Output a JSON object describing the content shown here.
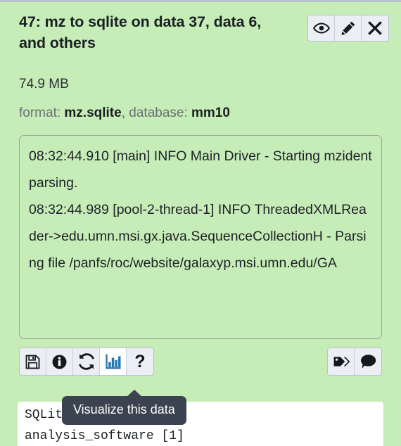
{
  "dataset": {
    "title": "47: mz to sqlite on data 37, data 6, and others",
    "size": "74.9 MB",
    "format_label": "format: ",
    "format_value": "mz.sqlite",
    "database_label": ", database: ",
    "database_value": "mm10",
    "log_text": "08:32:44.910 [main] INFO Main Driver - Starting mzident parsing.\n08:32:44.989 [pool-2-thread-1] INFO ThreadedXMLReader->edu.umn.msi.gx.java.SequenceCollectionH - Parsing file /panfs/roc/website/galaxyp.msi.umn.edu/GA"
  },
  "title_buttons": [
    {
      "name": "display-button",
      "icon": "eye-icon",
      "title": "Display"
    },
    {
      "name": "edit-button",
      "icon": "pencil-icon",
      "title": "Edit attributes"
    },
    {
      "name": "delete-button",
      "icon": "close-x-icon",
      "title": "Delete"
    }
  ],
  "action_buttons_left": [
    {
      "name": "save-download-button",
      "icon": "floppy-disk-icon",
      "title": "Download"
    },
    {
      "name": "dataset-details-button",
      "icon": "info-circle-icon",
      "title": "View details"
    },
    {
      "name": "rerun-button",
      "icon": "refresh-icon",
      "title": "Run this job again"
    },
    {
      "name": "visualize-button",
      "icon": "bar-chart-icon",
      "title": "Visualize this data",
      "active": true
    },
    {
      "name": "help-button",
      "icon": "question-mark-icon",
      "title": "Help",
      "glyph": "?"
    }
  ],
  "action_buttons_right": [
    {
      "name": "tags-button",
      "icon": "tag-icon",
      "title": "Edit dataset tags"
    },
    {
      "name": "annotation-button",
      "icon": "comment-icon",
      "title": "Edit dataset annotation"
    }
  ],
  "tooltip": {
    "text": "Visualize this data"
  },
  "preview": {
    "line1": "SQLite Database",
    "line2": "analysis_software [1]"
  },
  "colors": {
    "background_green": "#c6ecb8",
    "top_border": "#b6c2cc",
    "button_face": "#eceef3",
    "button_active": "#ffffff",
    "button_border": "#b9c0d4",
    "tooltip_bg": "#3c4350",
    "chart_blue": "#2878b0",
    "text_dark": "#1b1f23",
    "text_muted": "#6a6f75"
  }
}
